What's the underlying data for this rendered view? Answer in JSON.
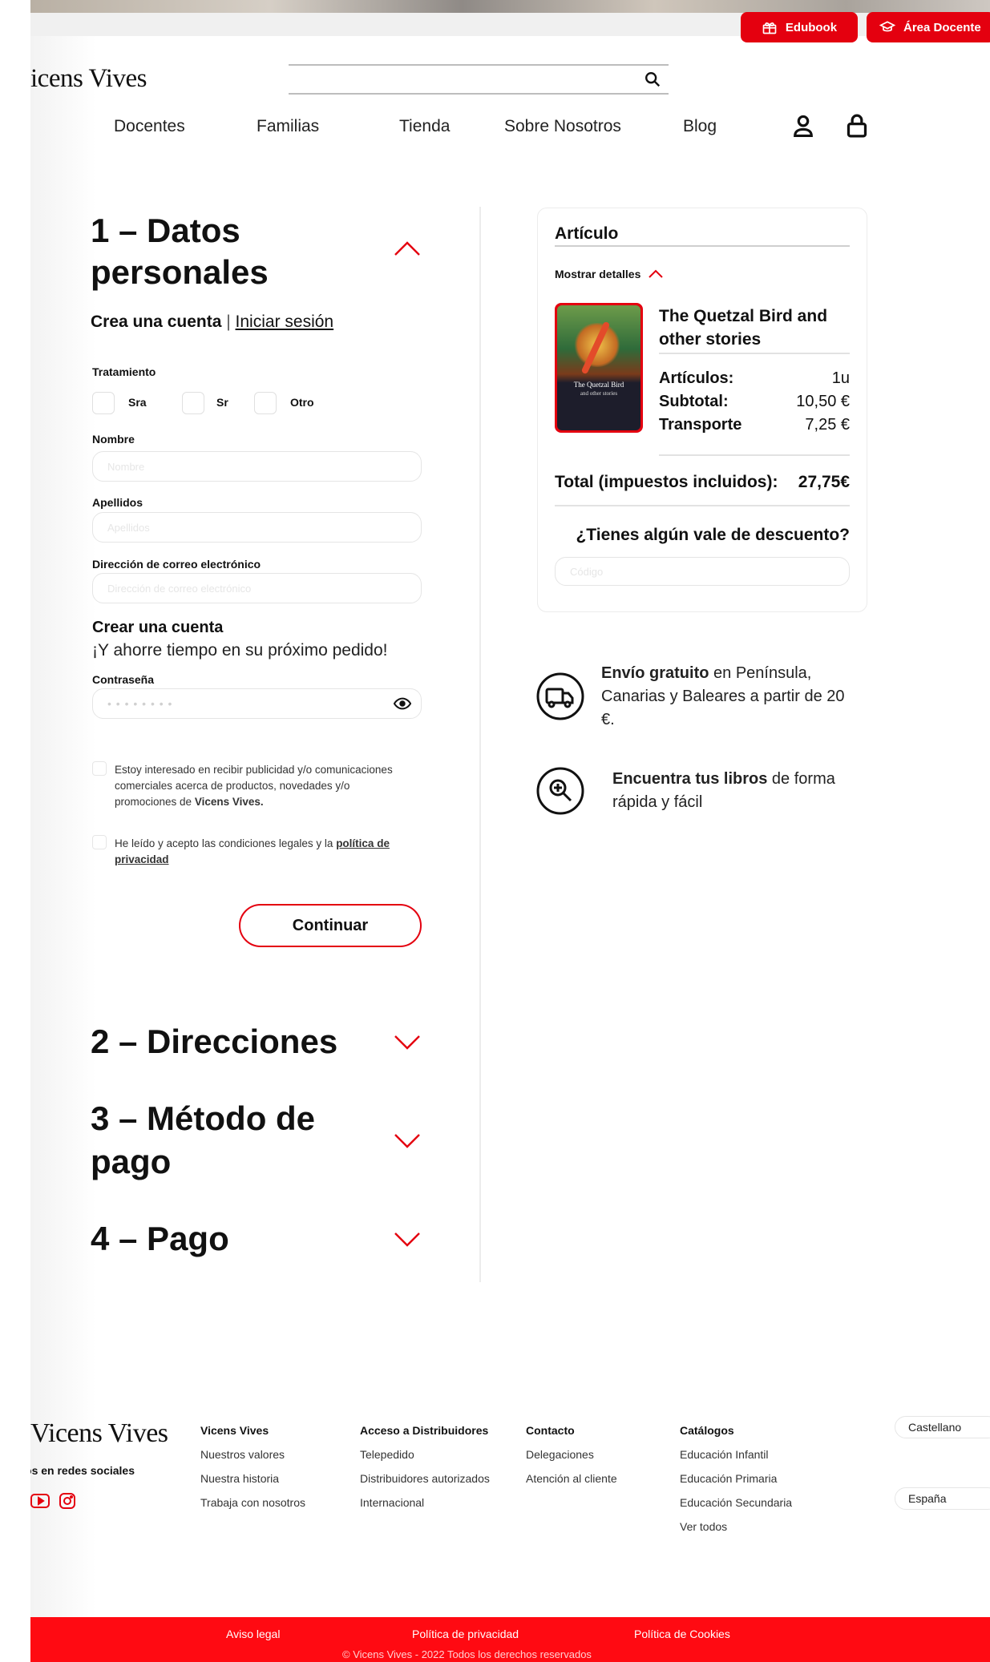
{
  "brand": {
    "logo_text": "icens Vives",
    "footer_logo_text": "Vicens Vives",
    "accent": "#e4000f"
  },
  "topbar": {
    "edubook_label": "Edubook",
    "area_docente_label": "Área Docente"
  },
  "nav": {
    "items": [
      "Docentes",
      "Familias",
      "Tienda",
      "Sobre Nosotros",
      "Blog"
    ]
  },
  "steps": {
    "step1_title_line1": "1 – Datos",
    "step1_title_line2": "personales",
    "step2_title": "2 – Direcciones",
    "step3_title_line1": "3 – Método de",
    "step3_title_line2": "pago",
    "step4_title": "4 – Pago"
  },
  "form": {
    "create_account": "Crea una cuenta",
    "separator": "|",
    "login_link": "Iniciar sesión",
    "treatment_label": "Tratamiento",
    "treatment_options": [
      "Sra",
      "Sr",
      "Otro"
    ],
    "name_label": "Nombre",
    "name_placeholder": "Nombre",
    "surname_label": "Apellidos",
    "surname_placeholder": "Apellidos",
    "email_label": "Dirección de correo electrónico",
    "email_placeholder": "Dirección de correo electrónico",
    "create_account_title": "Crear una cuenta",
    "create_account_sub": "¡Y ahorre tiempo en su próximo pedido!",
    "password_label": "Contraseña",
    "password_value": "• • • • • • • •",
    "promo_text_1": "Estoy interesado en recibir publicidad y/o comunicaciones",
    "promo_text_2": "comerciales acerca de productos, novedades y/o",
    "promo_text_3": "promociones de",
    "promo_brand": "Vicens Vives.",
    "legal_text_1": "He leído y acepto las condiciones legales y la",
    "legal_link_1": "política de",
    "legal_link_2": "privacidad",
    "continue_label": "Continuar"
  },
  "cart": {
    "title": "Artículo",
    "show_details": "Mostrar detalles",
    "book_title_line1": "The Quetzal Bird and",
    "book_title_line2": "other stories",
    "cover_title": "The Quetzal Bird",
    "cover_subtitle": "and other stories",
    "articles_label": "Artículos:",
    "articles_value": "1u",
    "subtotal_label": "Subtotal:",
    "subtotal_value": "10,50 €",
    "shipping_label": "Transporte",
    "shipping_value": "7,25 €",
    "total_label": "Total (impuestos incluidos):",
    "total_value": "27,75€",
    "discount_question": "¿Tienes algún vale de descuento?",
    "code_placeholder": "Código"
  },
  "benefits": {
    "shipping_bold": "Envío gratuito",
    "shipping_rest_1": " en Península,",
    "shipping_line_2": "Canarias y Baleares a partir de 20",
    "shipping_line_3": "€.",
    "books_bold": "Encuentra tus libros",
    "books_rest_1": " de forma",
    "books_line_2": "rápida y fácil"
  },
  "footer": {
    "social_label": "Síguenos en redes sociales:",
    "col1_title": "Vicens Vives",
    "col1_links": [
      "Nuestros valores",
      "Nuestra historia",
      "Trabaja con nosotros"
    ],
    "col2_title": "Acceso a Distribuidores",
    "col2_links": [
      "Telepedido",
      "Distribuidores autorizados",
      "Internacional"
    ],
    "col3_title": "Contacto",
    "col3_links": [
      "Delegaciones",
      "Atención al cliente"
    ],
    "col4_title": "Catálogos",
    "col4_links": [
      "Educación Infantil",
      "Educación Primaria",
      "Educación Secundaria",
      "Ver todos"
    ],
    "language": "Castellano",
    "country": "España",
    "legal": "Aviso legal",
    "privacy": "Política de privacidad",
    "cookies": "Política de Cookies",
    "copyright": "© Vicens Vives - 2022 Todos los derechos reservados"
  }
}
